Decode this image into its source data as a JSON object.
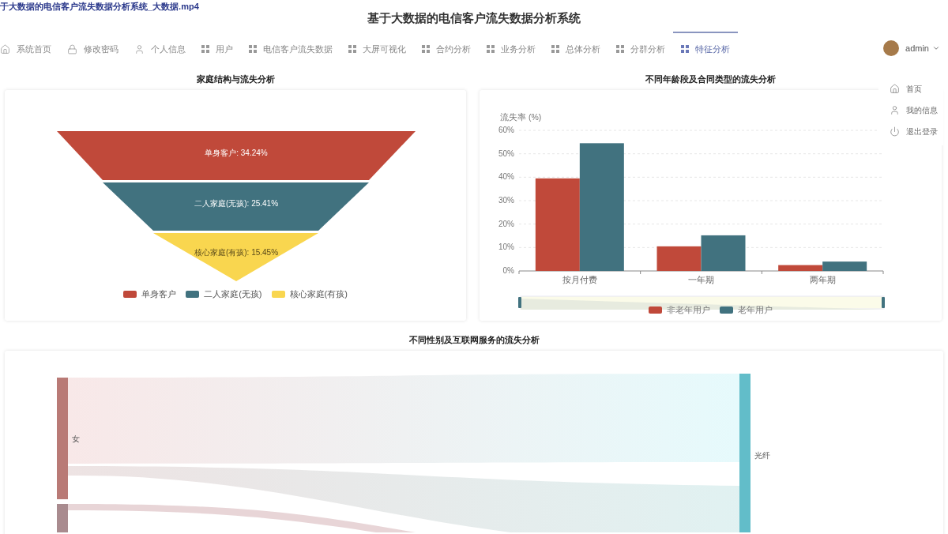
{
  "video_title": "于大数据的电信客户流失数据分析系统_大数据.mp4",
  "header": {
    "title": "基于大数据的电信客户流失数据分析系统"
  },
  "nav": {
    "items": [
      {
        "label": "系统首页",
        "selected": false
      },
      {
        "label": "修改密码",
        "selected": false
      },
      {
        "label": "个人信息",
        "selected": false
      },
      {
        "label": "用户",
        "selected": false
      },
      {
        "label": "电信客户流失数据",
        "selected": false
      },
      {
        "label": "大屏可视化",
        "selected": false
      },
      {
        "label": "合约分析",
        "selected": false
      },
      {
        "label": "业务分析",
        "selected": false
      },
      {
        "label": "总体分析",
        "selected": false
      },
      {
        "label": "分群分析",
        "selected": false
      },
      {
        "label": "特征分析",
        "selected": true
      }
    ]
  },
  "user_menu": {
    "username": "admin",
    "expanded": true,
    "items": [
      {
        "label": "首页"
      },
      {
        "label": "我的信息"
      },
      {
        "label": "退出登录"
      }
    ]
  },
  "family_panel": {
    "title": "家庭结构与流失分析",
    "funnel": [
      {
        "label": "单身客户: 34.24%",
        "color": "#c0493a"
      },
      {
        "label": "二人家庭(无孩): 25.41%",
        "color": "#41727f"
      },
      {
        "label": "核心家庭(有孩): 15.45%",
        "color": "#f9d64f"
      }
    ],
    "legend": [
      {
        "label": "单身客户",
        "color": "#c0493a"
      },
      {
        "label": "二人家庭(无孩)",
        "color": "#41727f"
      },
      {
        "label": "核心家庭(有孩)",
        "color": "#f9d64f"
      }
    ]
  },
  "age_contract_panel": {
    "title": "不同年龄段及合同类型的流失分析",
    "chart_data": {
      "type": "bar",
      "ylabel": "流失率 (%)",
      "categories": [
        "按月付费",
        "一年期",
        "两年期"
      ],
      "series": [
        {
          "name": "非老年用户",
          "color": "#c0493a",
          "values": [
            39.5,
            10.5,
            2.5
          ]
        },
        {
          "name": "老年用户",
          "color": "#41727f",
          "values": [
            54.5,
            15.2,
            4.0
          ]
        }
      ],
      "ylim": [
        0,
        60
      ],
      "grid": true,
      "yticks": [
        {
          "value": 0,
          "label": "0%"
        },
        {
          "value": 10,
          "label": "10%"
        },
        {
          "value": 20,
          "label": "20%"
        },
        {
          "value": 30,
          "label": "30%"
        },
        {
          "value": 40,
          "label": "40%"
        },
        {
          "value": 50,
          "label": "50%"
        },
        {
          "value": 60,
          "label": "60%"
        }
      ]
    }
  },
  "gender_internet_panel": {
    "title": "不同性别及互联网服务的流失分析",
    "nodes": [
      {
        "label": "女",
        "color": "#b97a76"
      },
      {
        "color": "#a98b8f"
      },
      {
        "label": "光纤",
        "color": "#62bdc9"
      }
    ]
  }
}
